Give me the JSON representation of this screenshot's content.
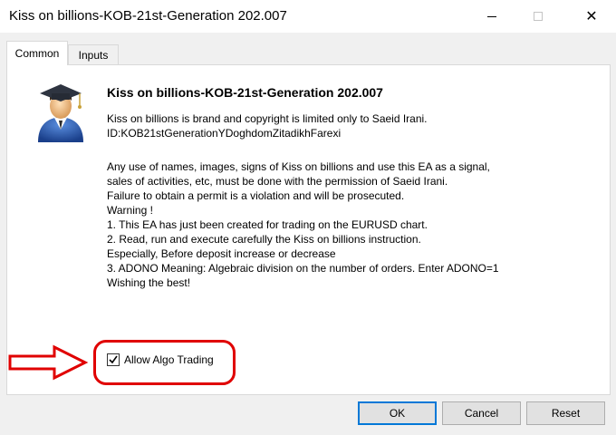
{
  "window": {
    "title": "Kiss on billions-KOB-21st-Generation 202.007",
    "close_glyph": "✕"
  },
  "tabs": [
    {
      "label": "Common",
      "active": true
    },
    {
      "label": "Inputs",
      "active": false
    }
  ],
  "content": {
    "heading": "Kiss on billions-KOB-21st-Generation 202.007",
    "copyright_lines": [
      "Kiss on billions is brand and copyright is limited only to Saeid Irani.",
      "ID:KOB21stGenerationYDoghdomZitadikhFarexi"
    ],
    "description_lines": [
      "Any use of names, images, signs of Kiss on billions and use this EA as a signal,",
      "sales of activities, etc, must be done with the permission of Saeid Irani.",
      "Failure to obtain a permit is a violation and will be prosecuted.",
      "Warning !",
      "1. This EA has just been created for trading on the EURUSD chart.",
      "2. Read, run and execute carefully the Kiss on billions instruction.",
      "Especially, Before deposit increase or decrease",
      "3. ADONO Meaning: Algebraic division on the number of orders. Enter ADONO=1",
      "Wishing the best!"
    ],
    "icon": "graduate-user-icon"
  },
  "algo_trading": {
    "label": "Allow Algo Trading",
    "checked": true
  },
  "buttons": {
    "ok": "OK",
    "cancel": "Cancel",
    "reset": "Reset"
  },
  "annotation_color": "#e00000",
  "accent_color": "#0078d7"
}
